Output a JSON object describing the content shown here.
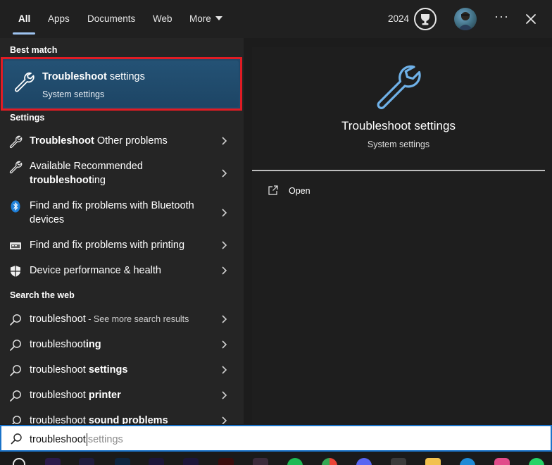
{
  "tabs": [
    {
      "label": "All",
      "active": true
    },
    {
      "label": "Apps"
    },
    {
      "label": "Documents"
    },
    {
      "label": "Web"
    },
    {
      "label": "More"
    }
  ],
  "header": {
    "points": "2024",
    "trophy_icon": "trophy-icon",
    "avatar_icon": "user-avatar",
    "more_options": "···",
    "close_icon": "close-icon"
  },
  "sections": {
    "best_match": "Best match",
    "settings": "Settings",
    "search_web": "Search the web"
  },
  "best_match": {
    "title_bold": "Troubleshoot",
    "title_rest": " settings",
    "subtitle": "System settings",
    "icon": "wrench-icon"
  },
  "settings_items": [
    {
      "bold": "Troubleshoot",
      "rest": " Other problems",
      "icon": "wrench-icon"
    },
    {
      "line1": "Available Recommended",
      "bold": "troubleshoot",
      "rest": "ing",
      "icon": "wrench-icon"
    },
    {
      "line1": "Find and fix problems with Bluetooth",
      "line2": "devices",
      "icon": "bluetooth-icon"
    },
    {
      "line1": "Find and fix problems with printing",
      "icon": "printer-icon"
    },
    {
      "line1": "Device performance & health",
      "icon": "shield-icon"
    }
  ],
  "web_items": [
    {
      "plain": "troubleshoot",
      "extra": " - See more search results"
    },
    {
      "plain": "troubleshoot",
      "bold": "ing"
    },
    {
      "plain": "troubleshoot ",
      "bold": "settings"
    },
    {
      "plain": "troubleshoot ",
      "bold": "printer"
    },
    {
      "plain": "troubleshoot ",
      "bold": "sound problems"
    }
  ],
  "preview": {
    "title": "Troubleshoot settings",
    "subtitle": "System settings",
    "open_label": "Open",
    "icon": "wrench-icon"
  },
  "search": {
    "typed": "troubleshoot",
    "suggestion": "settings"
  },
  "colors": {
    "accent": "#9ec3f0",
    "highlight_border": "#e01c24",
    "selected_bg": "#1f4a6c"
  }
}
